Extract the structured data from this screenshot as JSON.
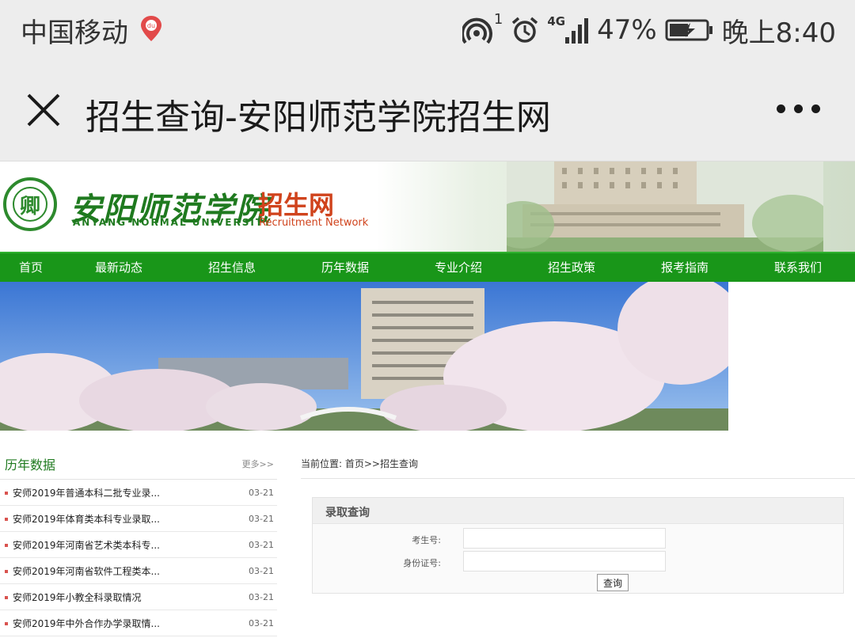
{
  "status_bar": {
    "carrier": "中国移动",
    "wifi_badge": "1",
    "network": "4G",
    "battery": "47%",
    "time": "晚上8:40"
  },
  "titlebar": {
    "title": "招生查询-安阳师范学院招生网"
  },
  "header": {
    "logo_cn": "安阳师范学院",
    "logo_en": "ANYANG NORMAL UNIVERSITY",
    "logo_zs": "招生网",
    "logo_rn": "Recruitment Network",
    "seal_char": "卿"
  },
  "nav": {
    "items": [
      "首页",
      "最新动态",
      "招生信息",
      "历年数据",
      "专业介绍",
      "招生政策",
      "报考指南",
      "联系我们"
    ]
  },
  "left": {
    "title": "历年数据",
    "more": "更多>>",
    "items": [
      {
        "title": "安师2019年普通本科二批专业录...",
        "date": "03-21"
      },
      {
        "title": "安师2019年体育类本科专业录取...",
        "date": "03-21"
      },
      {
        "title": "安师2019年河南省艺术类本科专...",
        "date": "03-21"
      },
      {
        "title": "安师2019年河南省软件工程类本...",
        "date": "03-21"
      },
      {
        "title": "安师2019年小教全科录取情况",
        "date": "03-21"
      },
      {
        "title": "安师2019年中外合作办学录取情...",
        "date": "03-21"
      }
    ]
  },
  "main": {
    "breadcrumb": "当前位置: 首页>>招生查询",
    "panel_title": "录取查询",
    "exam_label": "考生号:",
    "exam_value": "",
    "id_label": "身份证号:",
    "id_value": "",
    "submit_label": "查询"
  },
  "colors": {
    "nav_green": "#199619",
    "brand_green": "#1f7a1f",
    "brand_orange": "#d0431c"
  }
}
